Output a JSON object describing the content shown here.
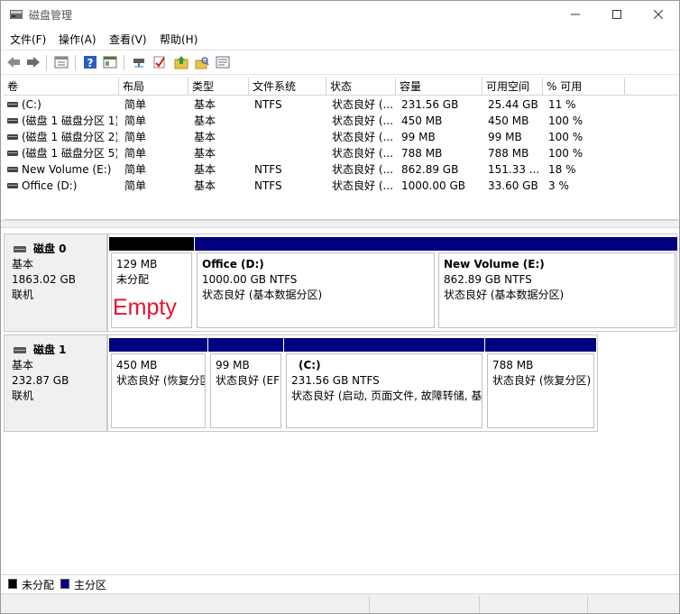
{
  "window": {
    "title": "磁盘管理"
  },
  "menu": [
    "文件(F)",
    "操作(A)",
    "查看(V)",
    "帮助(H)"
  ],
  "toolbar": [
    "back-icon",
    "forward-icon",
    "properties-icon",
    "help-icon",
    "view-icon",
    "connect-icon",
    "check-icon",
    "folder-up-icon",
    "search-folder-icon",
    "details-icon"
  ],
  "volume_list": {
    "columns": [
      "卷",
      "布局",
      "类型",
      "文件系统",
      "状态",
      "容量",
      "可用空间",
      "% 可用"
    ],
    "rows": [
      [
        "(C:)",
        "简单",
        "基本",
        "NTFS",
        "状态良好 (...",
        "231.56 GB",
        "25.44 GB",
        "11 %"
      ],
      [
        "(磁盘 1 磁盘分区 1)",
        "简单",
        "基本",
        "",
        "状态良好 (...",
        "450 MB",
        "450 MB",
        "100 %"
      ],
      [
        "(磁盘 1 磁盘分区 2)",
        "简单",
        "基本",
        "",
        "状态良好 (...",
        "99 MB",
        "99 MB",
        "100 %"
      ],
      [
        "(磁盘 1 磁盘分区 5)",
        "简单",
        "基本",
        "",
        "状态良好 (...",
        "788 MB",
        "788 MB",
        "100 %"
      ],
      [
        "New Volume (E:)",
        "简单",
        "基本",
        "NTFS",
        "状态良好 (...",
        "862.89 GB",
        "151.33 ...",
        "18 %"
      ],
      [
        "Office (D:)",
        "简单",
        "基本",
        "NTFS",
        "状态良好 (...",
        "1000.00 GB",
        "33.60 GB",
        "3 %"
      ]
    ]
  },
  "disks": [
    {
      "name": "磁盘 0",
      "type": "基本",
      "size": "1863.02 GB",
      "status": "联机",
      "partitions": [
        {
          "kind": "unallocated",
          "name": "",
          "line1": "129 MB",
          "line2": "未分配"
        },
        {
          "kind": "primary",
          "name": "Office  (D:)",
          "line1": "1000.00 GB NTFS",
          "line2": "状态良好 (基本数据分区)"
        },
        {
          "kind": "primary",
          "name": "New Volume  (E:)",
          "line1": "862.89 GB NTFS",
          "line2": "状态良好 (基本数据分区)"
        }
      ]
    },
    {
      "name": "磁盘 1",
      "type": "基本",
      "size": "232.87 GB",
      "status": "联机",
      "partitions": [
        {
          "kind": "primary",
          "name": "",
          "line1": "450 MB",
          "line2": "状态良好 (恢复分区)"
        },
        {
          "kind": "primary",
          "name": "",
          "line1": "99 MB",
          "line2": "状态良好 (EFI 系统分区)"
        },
        {
          "kind": "primary",
          "name": "(C:)",
          "line1": "231.56 GB NTFS",
          "line2": "状态良好 (启动, 页面文件, 故障转储, 基本数据分区)"
        },
        {
          "kind": "primary",
          "name": "",
          "line1": "788 MB",
          "line2": "状态良好 (恢复分区)"
        }
      ]
    }
  ],
  "annotation": "Empty",
  "legend": [
    {
      "label": "未分配",
      "color": "#000000"
    },
    {
      "label": "主分区",
      "color": "#000080"
    }
  ],
  "colors": {
    "primary": "#000080",
    "unallocated": "#000000",
    "annotation": "#e8112d"
  }
}
